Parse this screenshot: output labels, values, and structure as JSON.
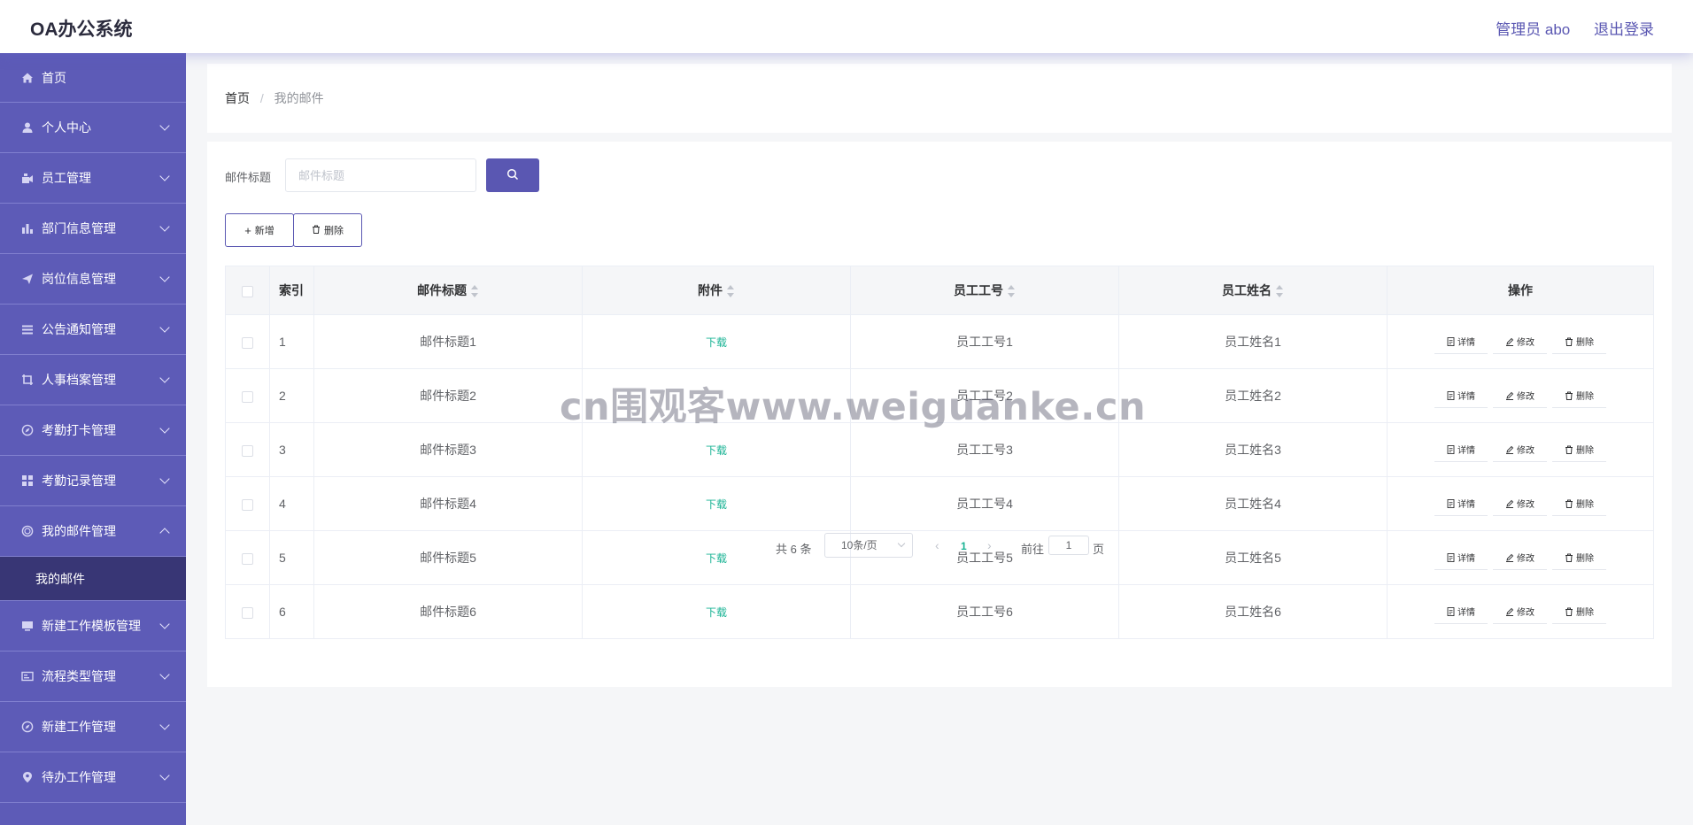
{
  "header": {
    "brand": "OA办公系统",
    "user": "管理员 abo",
    "logout": "退出登录"
  },
  "sidebar": {
    "items": [
      {
        "label": "首页",
        "icon": "home-icon"
      },
      {
        "label": "个人中心",
        "icon": "user-icon"
      },
      {
        "label": "员工管理",
        "icon": "employee-icon"
      },
      {
        "label": "部门信息管理",
        "icon": "bar-chart-icon"
      },
      {
        "label": "岗位信息管理",
        "icon": "send-icon"
      },
      {
        "label": "公告通知管理",
        "icon": "list-icon"
      },
      {
        "label": "人事档案管理",
        "icon": "crop-icon"
      },
      {
        "label": "考勤打卡管理",
        "icon": "compass-icon"
      },
      {
        "label": "考勤记录管理",
        "icon": "grid-icon"
      },
      {
        "label": "我的邮件管理",
        "icon": "circle-icon"
      },
      {
        "label": "新建工作模板管理",
        "icon": "monitor-icon"
      },
      {
        "label": "流程类型管理",
        "icon": "card-icon"
      },
      {
        "label": "新建工作管理",
        "icon": "compass-icon"
      },
      {
        "label": "待办工作管理",
        "icon": "pin-icon"
      }
    ],
    "active_sub": "我的邮件"
  },
  "breadcrumb": {
    "home": "首页",
    "separator": "/",
    "current": "我的邮件"
  },
  "search": {
    "label": "邮件标题",
    "placeholder": "邮件标题"
  },
  "actions": {
    "add": "新增",
    "delete": "删除"
  },
  "table": {
    "headers": [
      "索引",
      "邮件标题",
      "附件",
      "员工工号",
      "员工姓名",
      "操作"
    ],
    "rows": [
      {
        "index": "1",
        "title": "邮件标题1",
        "attachment": "下载",
        "emp_no": "员工工号1",
        "emp_name": "员工姓名1"
      },
      {
        "index": "2",
        "title": "邮件标题2",
        "attachment": "",
        "emp_no": "员工工号2",
        "emp_name": "员工姓名2"
      },
      {
        "index": "3",
        "title": "邮件标题3",
        "attachment": "下载",
        "emp_no": "员工工号3",
        "emp_name": "员工姓名3"
      },
      {
        "index": "4",
        "title": "邮件标题4",
        "attachment": "下载",
        "emp_no": "员工工号4",
        "emp_name": "员工姓名4"
      },
      {
        "index": "5",
        "title": "邮件标题5",
        "attachment": "下载",
        "emp_no": "员工工号5",
        "emp_name": "员工姓名5"
      },
      {
        "index": "6",
        "title": "邮件标题6",
        "attachment": "下载",
        "emp_no": "员工工号6",
        "emp_name": "员工姓名6"
      }
    ],
    "row_actions": {
      "detail": "详情",
      "edit": "修改",
      "delete": "删除"
    }
  },
  "pagination": {
    "total": "共 6 条",
    "page_size": "10条/页",
    "current_page": "1",
    "goto_label": "前往",
    "goto_value": "1",
    "page_unit": "页"
  },
  "watermark": "cn围观客www.weiguanke.cn",
  "colors": {
    "sidebar": "#5d5bb7",
    "sidebar_active": "#383675",
    "accent": "#5a57b2",
    "download": "#19b394"
  }
}
